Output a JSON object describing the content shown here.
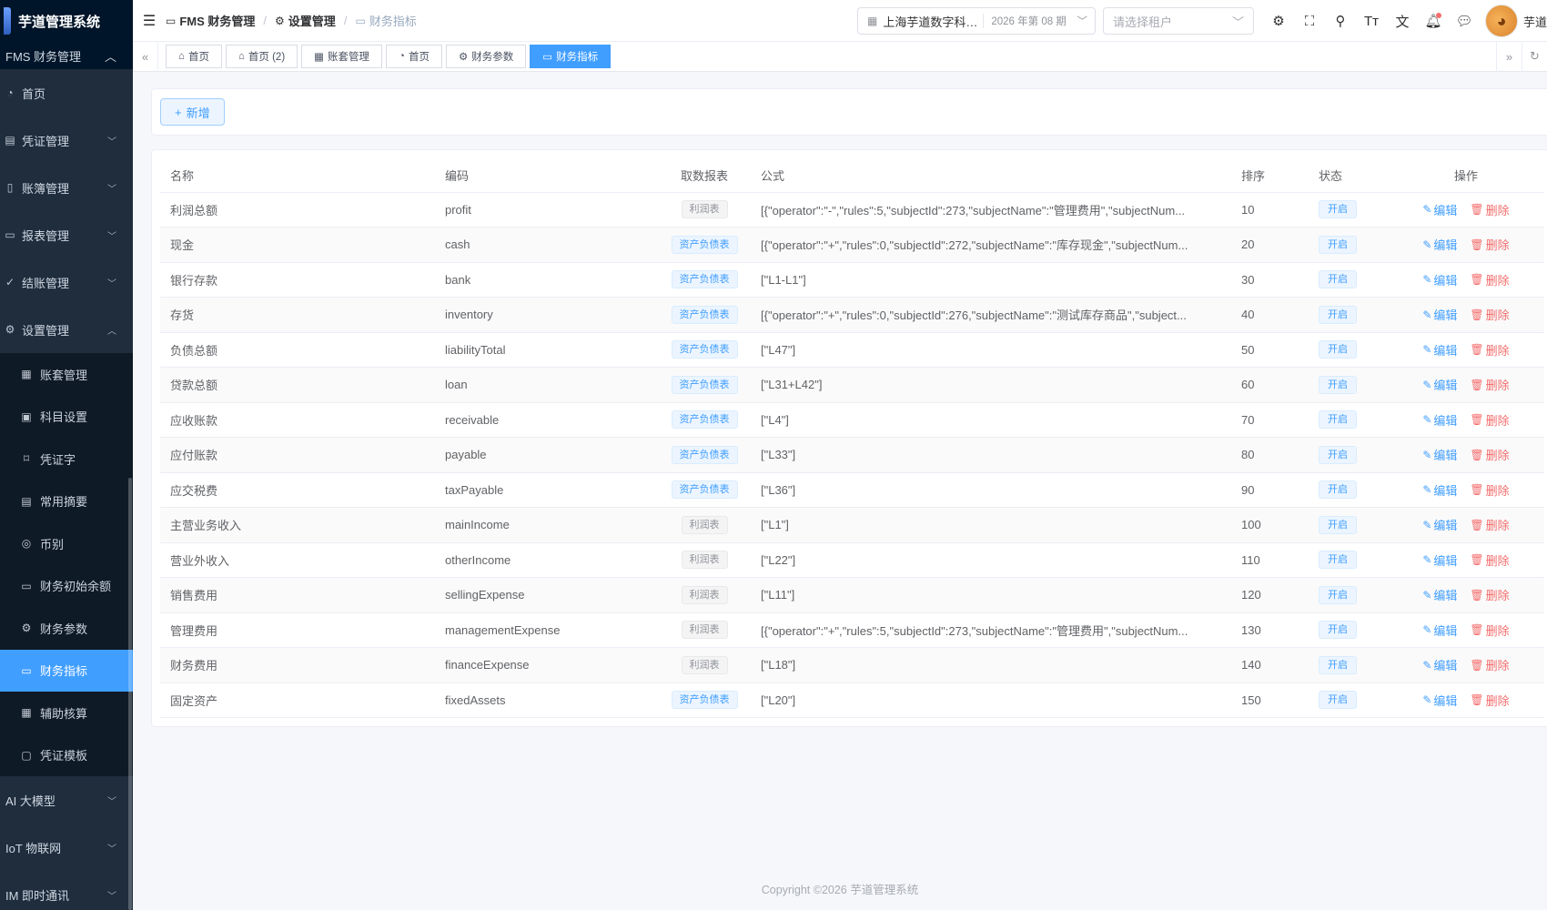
{
  "app": {
    "title": "芋道管理系统"
  },
  "sidebar": {
    "group_title": "FMS 财务管理",
    "items": [
      {
        "label": "首页",
        "icon": "dashboard-icon"
      },
      {
        "label": "凭证管理",
        "icon": "voucher-icon"
      },
      {
        "label": "账簿管理",
        "icon": "ledger-icon"
      },
      {
        "label": "报表管理",
        "icon": "report-icon"
      },
      {
        "label": "结账管理",
        "icon": "check-circle-icon"
      },
      {
        "label": "设置管理",
        "icon": "gear-icon"
      }
    ],
    "settings_children": [
      {
        "label": "账套管理",
        "icon": "building-icon"
      },
      {
        "label": "科目设置",
        "icon": "clipboard-icon"
      },
      {
        "label": "凭证字",
        "icon": "bookmark-icon"
      },
      {
        "label": "常用摘要",
        "icon": "document-icon"
      },
      {
        "label": "币别",
        "icon": "coins-icon"
      },
      {
        "label": "财务初始余额",
        "icon": "balance-icon"
      },
      {
        "label": "财务参数",
        "icon": "gear-icon"
      },
      {
        "label": "财务指标",
        "icon": "monitor-icon"
      },
      {
        "label": "辅助核算",
        "icon": "grid-icon"
      },
      {
        "label": "凭证模板",
        "icon": "template-icon"
      }
    ],
    "bottom_items": [
      {
        "label": "AI 大模型"
      },
      {
        "label": "IoT 物联网"
      },
      {
        "label": "IM 即时通讯"
      }
    ]
  },
  "header": {
    "breadcrumb": [
      "FMS 财务管理",
      "设置管理",
      "财务指标"
    ],
    "tenant_name": "上海芋道数字科技有限公司",
    "period": "2026 年第 08 期",
    "tenant_placeholder": "请选择租户",
    "user_name": "芋道"
  },
  "tags": [
    {
      "label": "首页",
      "icon": "home-icon"
    },
    {
      "label": "首页 (2)",
      "icon": "home-icon"
    },
    {
      "label": "账套管理",
      "icon": "building-icon"
    },
    {
      "label": "首页",
      "icon": "dashboard-icon"
    },
    {
      "label": "财务参数",
      "icon": "gear-icon"
    },
    {
      "label": "财务指标",
      "icon": "monitor-icon",
      "active": true
    }
  ],
  "toolbar": {
    "add_label": "新增"
  },
  "table": {
    "headers": {
      "name": "名称",
      "code": "编码",
      "report": "取数报表",
      "formula": "公式",
      "sort": "排序",
      "status": "状态",
      "actions": "操作"
    },
    "edit_label": "编辑",
    "delete_label": "删除",
    "rows": [
      {
        "name": "利润总额",
        "code": "profit",
        "report": "利润表",
        "type": "profit",
        "formula": "[{\"operator\":\"-\",\"rules\":5,\"subjectId\":273,\"subjectName\":\"管理费用\",\"subjectNum...",
        "sort": "10",
        "status": "开启"
      },
      {
        "name": "现金",
        "code": "cash",
        "report": "资产负债表",
        "type": "balance",
        "formula": "[{\"operator\":\"+\",\"rules\":0,\"subjectId\":272,\"subjectName\":\"库存现金\",\"subjectNum...",
        "sort": "20",
        "status": "开启"
      },
      {
        "name": "银行存款",
        "code": "bank",
        "report": "资产负债表",
        "type": "balance",
        "formula": "[\"L1-L1\"]",
        "sort": "30",
        "status": "开启"
      },
      {
        "name": "存货",
        "code": "inventory",
        "report": "资产负债表",
        "type": "balance",
        "formula": "[{\"operator\":\"+\",\"rules\":0,\"subjectId\":276,\"subjectName\":\"测试库存商品\",\"subject...",
        "sort": "40",
        "status": "开启"
      },
      {
        "name": "负债总额",
        "code": "liabilityTotal",
        "report": "资产负债表",
        "type": "balance",
        "formula": "[\"L47\"]",
        "sort": "50",
        "status": "开启"
      },
      {
        "name": "贷款总额",
        "code": "loan",
        "report": "资产负债表",
        "type": "balance",
        "formula": "[\"L31+L42\"]",
        "sort": "60",
        "status": "开启"
      },
      {
        "name": "应收账款",
        "code": "receivable",
        "report": "资产负债表",
        "type": "balance",
        "formula": "[\"L4\"]",
        "sort": "70",
        "status": "开启"
      },
      {
        "name": "应付账款",
        "code": "payable",
        "report": "资产负债表",
        "type": "balance",
        "formula": "[\"L33\"]",
        "sort": "80",
        "status": "开启"
      },
      {
        "name": "应交税费",
        "code": "taxPayable",
        "report": "资产负债表",
        "type": "balance",
        "formula": "[\"L36\"]",
        "sort": "90",
        "status": "开启"
      },
      {
        "name": "主营业务收入",
        "code": "mainIncome",
        "report": "利润表",
        "type": "profit",
        "formula": "[\"L1\"]",
        "sort": "100",
        "status": "开启"
      },
      {
        "name": "营业外收入",
        "code": "otherIncome",
        "report": "利润表",
        "type": "profit",
        "formula": "[\"L22\"]",
        "sort": "110",
        "status": "开启"
      },
      {
        "name": "销售费用",
        "code": "sellingExpense",
        "report": "利润表",
        "type": "profit",
        "formula": "[\"L11\"]",
        "sort": "120",
        "status": "开启"
      },
      {
        "name": "管理费用",
        "code": "managementExpense",
        "report": "利润表",
        "type": "profit",
        "formula": "[{\"operator\":\"+\",\"rules\":5,\"subjectId\":273,\"subjectName\":\"管理费用\",\"subjectNum...",
        "sort": "130",
        "status": "开启"
      },
      {
        "name": "财务费用",
        "code": "financeExpense",
        "report": "利润表",
        "type": "profit",
        "formula": "[\"L18\"]",
        "sort": "140",
        "status": "开启"
      },
      {
        "name": "固定资产",
        "code": "fixedAssets",
        "report": "资产负债表",
        "type": "balance",
        "formula": "[\"L20\"]",
        "sort": "150",
        "status": "开启"
      }
    ]
  },
  "footer": {
    "copyright": "Copyright ©2026 芋道管理系统"
  },
  "colors": {
    "accent": "#409eff",
    "danger": "#f56c6c",
    "sidebar_bg": "#1f2d3d"
  }
}
